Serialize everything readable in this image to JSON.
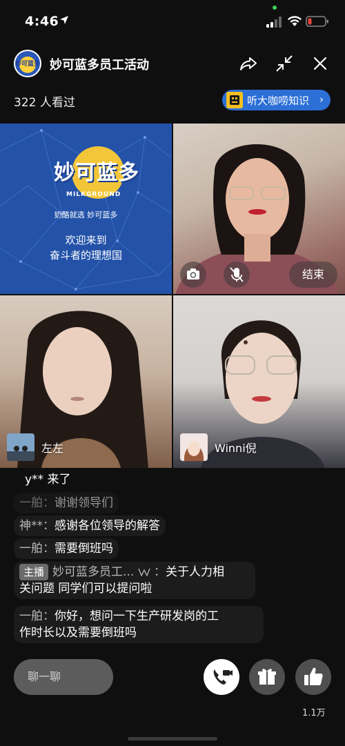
{
  "status_bar": {
    "time": "4:46"
  },
  "header": {
    "logo_text": "妙可蓝多",
    "title": "妙可蓝多员工活动",
    "viewers": "322 人看过",
    "promo_label": "听大咖唠知识",
    "promo_chevron": "›"
  },
  "video": {
    "brand_name": "妙可蓝多",
    "brand_en": "MILKGROUND",
    "slogan": "奶酪就选 妙可蓝多",
    "welcome_line1": "欢迎来到",
    "welcome_line2": "奋斗者的理想国",
    "end_label": "结束",
    "name_left": "左左",
    "name_right": "Winni倪"
  },
  "chat": [
    {
      "nick": "",
      "text": "y** 来了",
      "faded": false
    },
    {
      "nick": "一舶：",
      "text": "谢谢领导们",
      "faded": true
    },
    {
      "nick": "神**：",
      "text": "感谢各位领导的解答",
      "faded": false
    },
    {
      "nick": "一舶：",
      "text": "需要倒班吗",
      "faded": false
    },
    {
      "badge": "主播",
      "nick": "妙可蓝多员工...",
      "text": "关于人力相",
      "text2": "关问题 同学们可以提问啦"
    },
    {
      "nick": "一舶：",
      "text": "你好，想问一下生产研发岗的工",
      "text2": "作时长以及需要倒班吗"
    }
  ],
  "bottom": {
    "chat_placeholder": "聊一聊",
    "like_count": "1.1万"
  },
  "colors": {
    "background": "#0f0f0f",
    "promo": "#2c6fd6",
    "brand_tile": "#2352a8",
    "battery_low": "#e8463b"
  }
}
